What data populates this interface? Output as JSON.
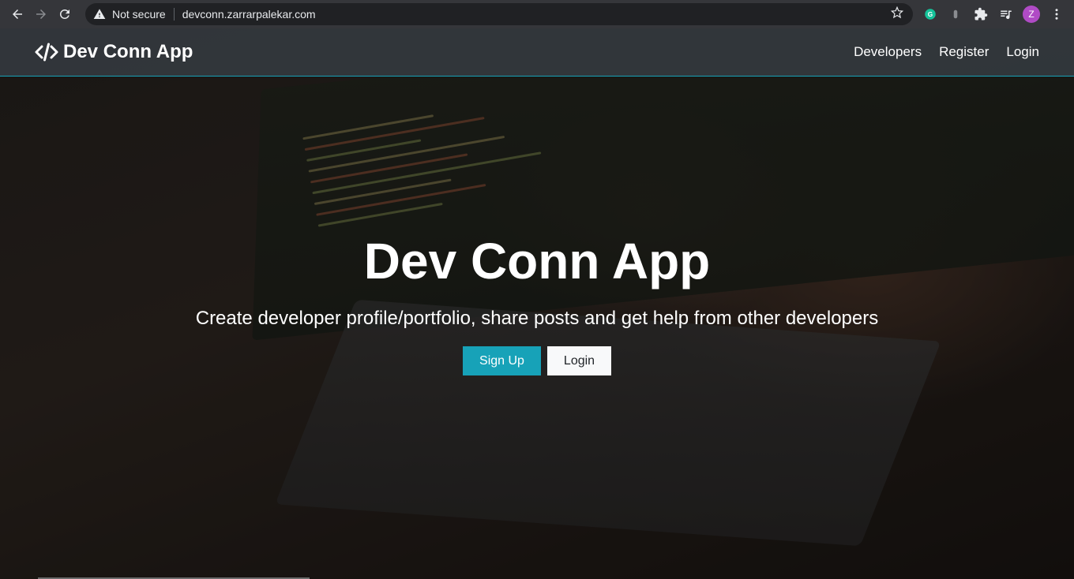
{
  "browser": {
    "security_label": "Not secure",
    "url": "devconn.zarrarpalekar.com",
    "profile_initial": "Z",
    "icons": [
      "back-icon",
      "forward-icon",
      "reload-icon",
      "warning-icon",
      "star-icon",
      "grammarly-icon",
      "extension-icon",
      "puzzle-icon",
      "media-icon",
      "menu-icon"
    ]
  },
  "navbar": {
    "brand": "Dev Conn App",
    "links": [
      "Developers",
      "Register",
      "Login"
    ]
  },
  "hero": {
    "title": "Dev Conn App",
    "lead": "Create developer profile/portfolio, share posts and get help from other developers",
    "signup_label": "Sign Up",
    "login_label": "Login"
  },
  "colors": {
    "accent": "#17a2b8",
    "navbar": "#343a40",
    "chrome": "#35363a"
  }
}
